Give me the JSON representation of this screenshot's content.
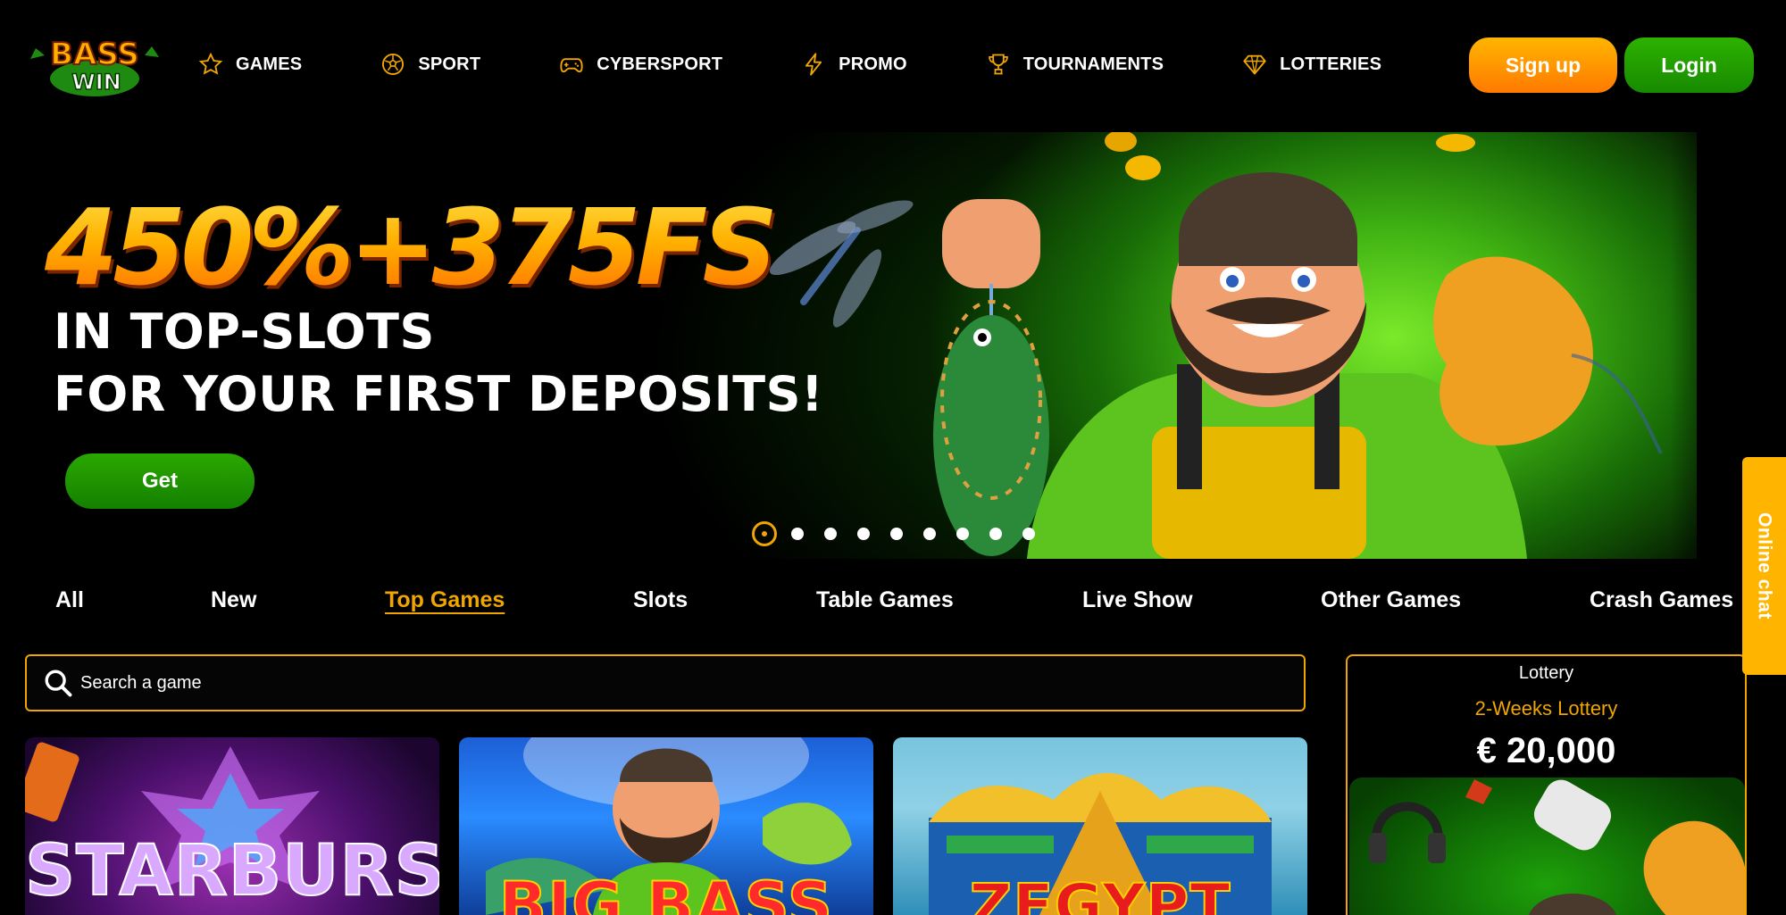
{
  "brand": {
    "logo_line1": "BASS",
    "logo_line2": "WIN",
    "accent": "#f0a500",
    "green": "#1a9400"
  },
  "nav": [
    {
      "label": "GAMES",
      "icon": "star-icon"
    },
    {
      "label": "SPORT",
      "icon": "soccer-ball-icon"
    },
    {
      "label": "CYBERSPORT",
      "icon": "gamepad-icon"
    },
    {
      "label": "PROMO",
      "icon": "lightning-icon"
    },
    {
      "label": "TOURNAMENTS",
      "icon": "trophy-icon"
    },
    {
      "label": "LOTTERIES",
      "icon": "diamond-icon"
    }
  ],
  "auth": {
    "signup": "Sign up",
    "login": "Login"
  },
  "banner": {
    "headline": "450%+375FS",
    "line1": "IN TOP-SLOTS",
    "line2": "FOR YOUR FIRST DEPOSITS!",
    "cta": "Get",
    "slides_total": 9,
    "active_slide": 1
  },
  "tabs": [
    {
      "label": "All",
      "active": false
    },
    {
      "label": "New",
      "active": false
    },
    {
      "label": "Top Games",
      "active": true
    },
    {
      "label": "Slots",
      "active": false
    },
    {
      "label": "Table Games",
      "active": false
    },
    {
      "label": "Live Show",
      "active": false
    },
    {
      "label": "Other Games",
      "active": false
    },
    {
      "label": "Crash Games",
      "active": false
    }
  ],
  "search": {
    "placeholder": "Search a game"
  },
  "games": [
    {
      "title": "STARBURST"
    },
    {
      "title": "BIG BASS"
    },
    {
      "title": "ZEGYPT"
    }
  ],
  "lottery": {
    "label": "Lottery",
    "name": "2-Weeks Lottery",
    "amount": "€ 20,000"
  },
  "chat": {
    "label": "Online chat"
  }
}
